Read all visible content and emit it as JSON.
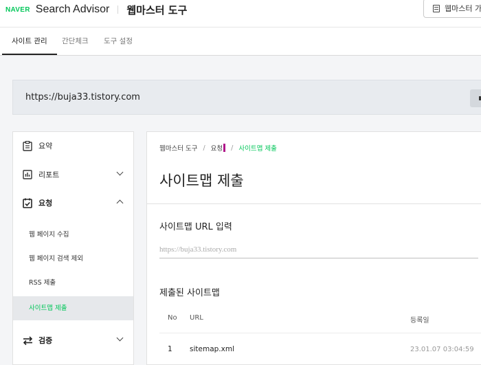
{
  "header": {
    "logo": "NAVER",
    "product": "Search Advisor",
    "section": "웹마스터 도구",
    "top_button": "웹마스터 가이드"
  },
  "tabs": [
    {
      "label": "사이트 관리",
      "active": true
    },
    {
      "label": "간단체크",
      "active": false
    },
    {
      "label": "도구 설정",
      "active": false
    }
  ],
  "site": {
    "url": "https://buja33.tistory.com"
  },
  "sidebar": {
    "items": [
      {
        "label": "요약",
        "icon": "summary-icon",
        "bold": false
      },
      {
        "label": "리포트",
        "icon": "report-icon",
        "bold": false
      },
      {
        "label": "요청",
        "icon": "request-icon",
        "bold": true
      },
      {
        "label": "검증",
        "icon": "verify-icon",
        "bold": true
      }
    ],
    "sub_items": [
      {
        "label": "웹 페이지 수집",
        "active": false
      },
      {
        "label": "웹 페이지 검색 제외",
        "active": false
      },
      {
        "label": "RSS 제출",
        "active": false
      },
      {
        "label": "사이트맵 제출",
        "active": true
      }
    ]
  },
  "main": {
    "breadcrumb": [
      "웹마스터 도구",
      "요청",
      "사이트맵 제출"
    ],
    "title": "사이트맵 제출",
    "input_section": "사이트맵 URL 입력",
    "input_placeholder": "https://buja33.tistory.com",
    "submitted_section": "제출된 사이트맵",
    "table": {
      "headers": [
        "No",
        "URL",
        "등록일"
      ],
      "rows": [
        {
          "no": "1",
          "url": "sitemap.xml",
          "date": "23.01.07 03:04:59"
        }
      ]
    }
  },
  "colors": {
    "accent": "#03c75a",
    "active_bg": "#e6e8eb"
  }
}
